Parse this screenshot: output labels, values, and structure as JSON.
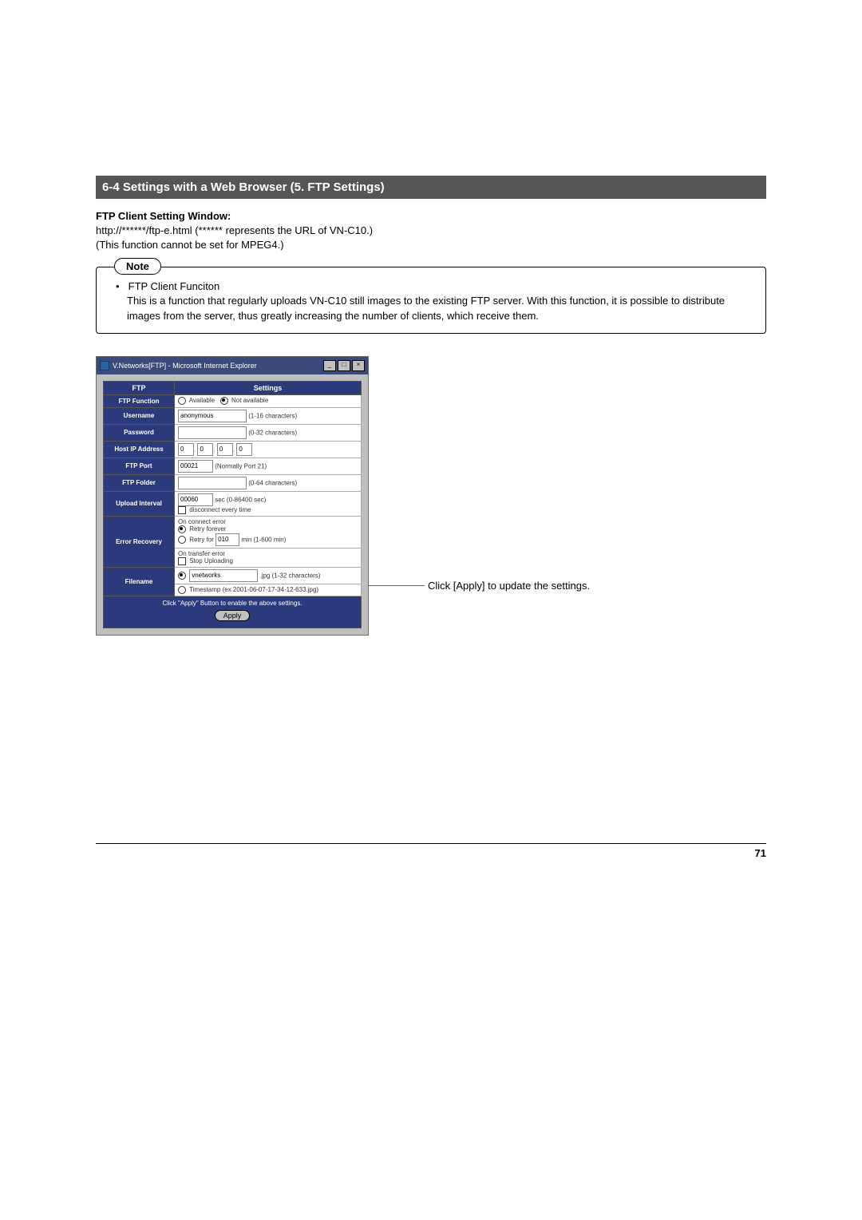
{
  "section_header": "6-4 Settings with a Web Browser (5. FTP Settings)",
  "subheading": "FTP Client Setting Window:",
  "body_line1": "http://******/ftp-e.html (****** represents the URL of VN-C10.)",
  "body_line2": "(This function cannot be set for MPEG4.)",
  "note": {
    "label": "Note",
    "bullet": "•",
    "title": "FTP Client Funciton",
    "desc": "This is a function that regularly uploads VN-C10 still images to the existing FTP server. With this function, it is possible to distribute images from the server, thus greatly increasing the number of clients, which receive them."
  },
  "ie": {
    "title": "V.Networks[FTP] - Microsoft Internet Explorer",
    "min": "_",
    "max": "□",
    "close": "×",
    "header_left": "FTP",
    "header_right": "Settings",
    "rows": {
      "ftp_function": {
        "label": "FTP Function",
        "opt1": "Available",
        "opt2": "Not available"
      },
      "username": {
        "label": "Username",
        "value": "anonymous",
        "hint": "(1-16 characters)"
      },
      "password": {
        "label": "Password",
        "value": "",
        "hint": "(0-32 characters)"
      },
      "host": {
        "label": "Host IP Address",
        "v1": "0",
        "v2": "0",
        "v3": "0",
        "v4": "0"
      },
      "port": {
        "label": "FTP Port",
        "value": "00021",
        "hint": "(Normally Port 21)"
      },
      "folder": {
        "label": "FTP Folder",
        "value": "",
        "hint": "(0-64 characters)"
      },
      "interval": {
        "label": "Upload Interval",
        "value": "00060",
        "unit": "sec (0-86400 sec)",
        "chk": "disconnect every time"
      },
      "error": {
        "label": "Error Recovery",
        "sec1": "On connect error",
        "opt1": "Retry forever",
        "opt2_pre": "Retry for",
        "opt2_val": "010",
        "opt2_post": "min (1-600 min)",
        "sec2": "On transfer error",
        "chk": "Stop Uploading"
      },
      "filename": {
        "label": "Filename",
        "opt1_val": "vnetworks",
        "opt1_hint": ".jpg (1-32 characters)",
        "opt2": "Timestamp (ex.2001-06-07-17-34-12-633.jpg)"
      }
    },
    "apply_hint": "Click \"Apply\" Button to enable the above settings.",
    "apply_label": "Apply"
  },
  "callout": "Click [Apply] to update the settings.",
  "page_number": "71"
}
